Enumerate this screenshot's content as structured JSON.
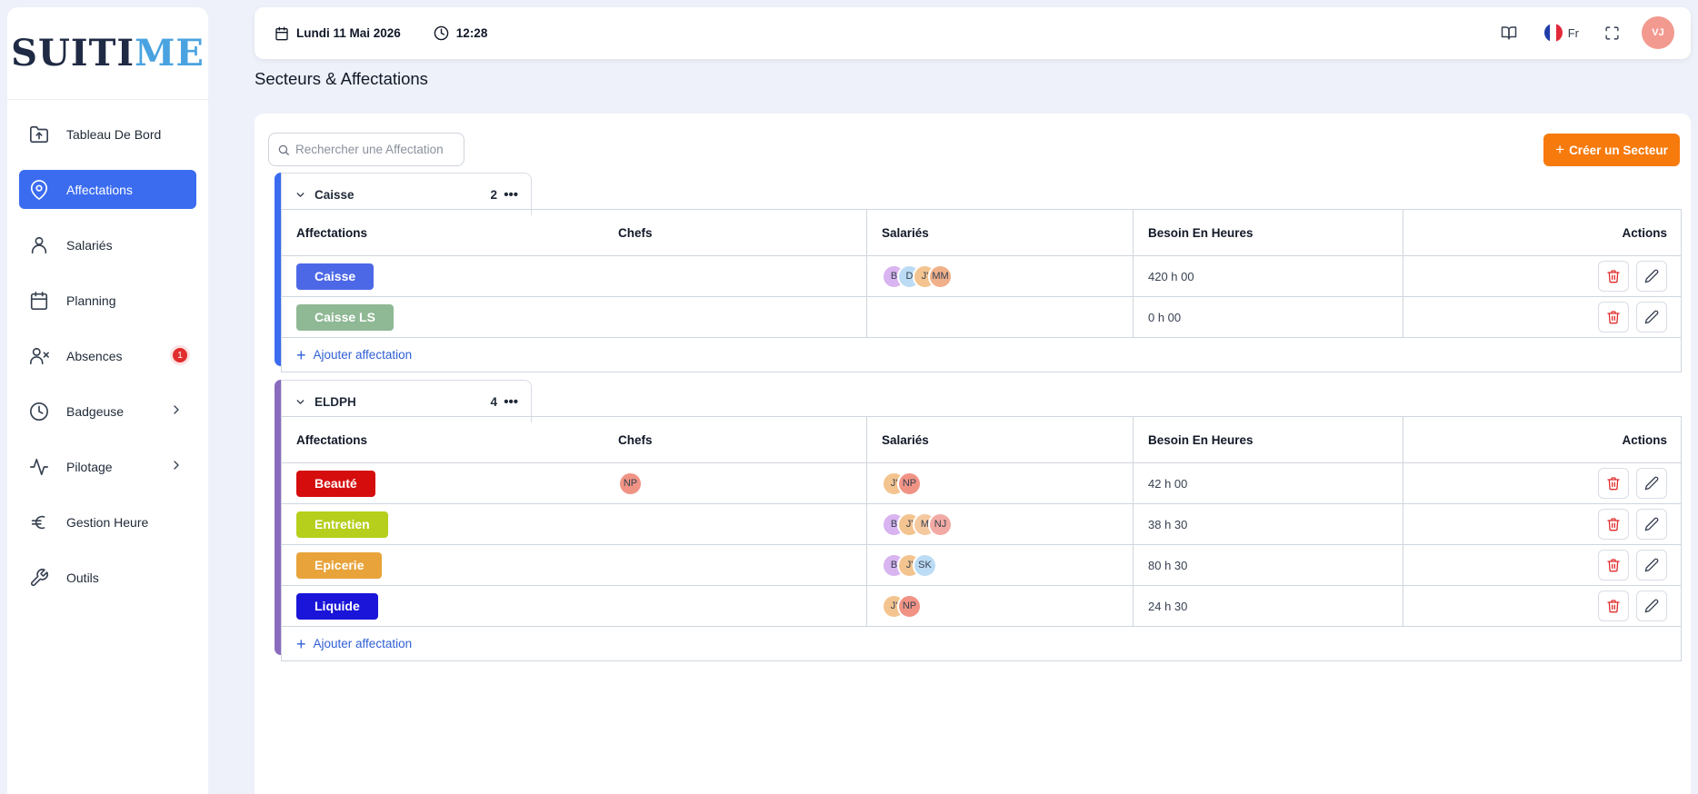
{
  "app": {
    "logo_main": "SUIT",
    "logo_i": "I",
    "logo_end": "ME"
  },
  "sidebar": {
    "items": [
      {
        "label": "Tableau De Bord",
        "icon": "folder-upload-icon"
      },
      {
        "label": "Affectations",
        "icon": "location-pin-icon",
        "active": true
      },
      {
        "label": "Salariés",
        "icon": "user-icon"
      },
      {
        "label": "Planning",
        "icon": "calendar-icon"
      },
      {
        "label": "Absences",
        "icon": "user-x-icon",
        "badge": "1"
      },
      {
        "label": "Badgeuse",
        "icon": "clock-icon",
        "chevron": true
      },
      {
        "label": "Pilotage",
        "icon": "activity-icon",
        "chevron": true
      },
      {
        "label": "Gestion Heure",
        "icon": "euro-icon"
      },
      {
        "label": "Outils",
        "icon": "wrench-icon"
      }
    ]
  },
  "topbar": {
    "date": "Lundi 11 Mai 2026",
    "time": "12:28",
    "language": "Fr",
    "user_initials": "VJ"
  },
  "page": {
    "title": "Secteurs & Affectations"
  },
  "toolbar": {
    "search_placeholder": "Rechercher une Affectation",
    "create_label": "Créer un Secteur"
  },
  "columns": [
    "Affectations",
    "Chefs",
    "Salariés",
    "Besoin En Heures",
    "Actions"
  ],
  "add_label": "Ajouter affectation",
  "colors": {
    "accent": "#3b6cf0",
    "create": "#f77a0c",
    "sector1": "#3b6cf0",
    "sector2": "#8b6bbd"
  },
  "sectors": [
    {
      "name": "Caisse",
      "count": "2",
      "color": "#3b6cf0",
      "rows": [
        {
          "tag": "Caisse",
          "color": "#4d68e6",
          "chefs": [],
          "salaries": [
            {
              "i": "B",
              "bg": "#d8b4f0"
            },
            {
              "i": "D",
              "bg": "#bcdcf5"
            },
            {
              "i": "J'",
              "bg": "#f3c48f"
            },
            {
              "i": "MM",
              "bg": "#f0b08a"
            }
          ],
          "hours": "420 h 00"
        },
        {
          "tag": "Caisse LS",
          "color": "#8fb894",
          "chefs": [],
          "salaries": [],
          "hours": "0 h 00"
        }
      ]
    },
    {
      "name": "ELDPH",
      "count": "4",
      "color": "#8b6bbd",
      "rows": [
        {
          "tag": "Beauté",
          "color": "#d60d0d",
          "chefs": [
            {
              "i": "NP",
              "bg": "#f09385"
            }
          ],
          "salaries": [
            {
              "i": "J'",
              "bg": "#f3c48f"
            },
            {
              "i": "NP",
              "bg": "#f09385"
            }
          ],
          "hours": "42 h 00"
        },
        {
          "tag": "Entretien",
          "color": "#b5cf1c",
          "chefs": [],
          "salaries": [
            {
              "i": "B",
              "bg": "#d8b4f0"
            },
            {
              "i": "J'",
              "bg": "#f3c48f"
            },
            {
              "i": "M",
              "bg": "#f5c9a0"
            },
            {
              "i": "NJ",
              "bg": "#f2aaa4"
            }
          ],
          "hours": "38 h 30"
        },
        {
          "tag": "Epicerie",
          "color": "#e8a33a",
          "chefs": [],
          "salaries": [
            {
              "i": "B",
              "bg": "#d8b4f0"
            },
            {
              "i": "J'",
              "bg": "#f3c48f"
            },
            {
              "i": "SK",
              "bg": "#bcdcf5"
            }
          ],
          "hours": "80 h 30"
        },
        {
          "tag": "Liquide",
          "color": "#1a15d8",
          "chefs": [],
          "salaries": [
            {
              "i": "J'",
              "bg": "#f3c48f"
            },
            {
              "i": "NP",
              "bg": "#f09385"
            }
          ],
          "hours": "24 h 30"
        }
      ]
    }
  ]
}
